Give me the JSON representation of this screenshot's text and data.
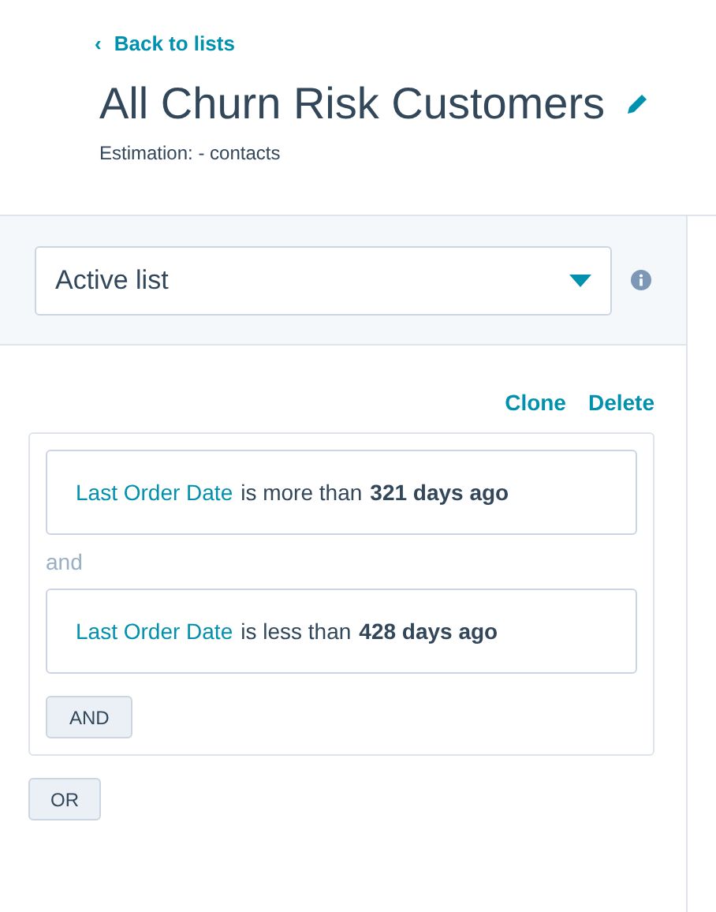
{
  "header": {
    "back_link": "Back to lists",
    "back_icon": "‹",
    "title": "All Churn Risk Customers",
    "estimation": "Estimation: - contacts"
  },
  "list_type": {
    "value": "Active list"
  },
  "actions": [
    "Clone",
    "Delete"
  ],
  "filter_group": {
    "conditions": [
      {
        "property": "Last Order Date",
        "operator": "is more than",
        "value": "321 days ago"
      },
      {
        "property": "Last Order Date",
        "operator": "is less than",
        "value": "428 days ago"
      }
    ],
    "joiner": "and",
    "and_button": "AND"
  },
  "or_button": "OR"
}
